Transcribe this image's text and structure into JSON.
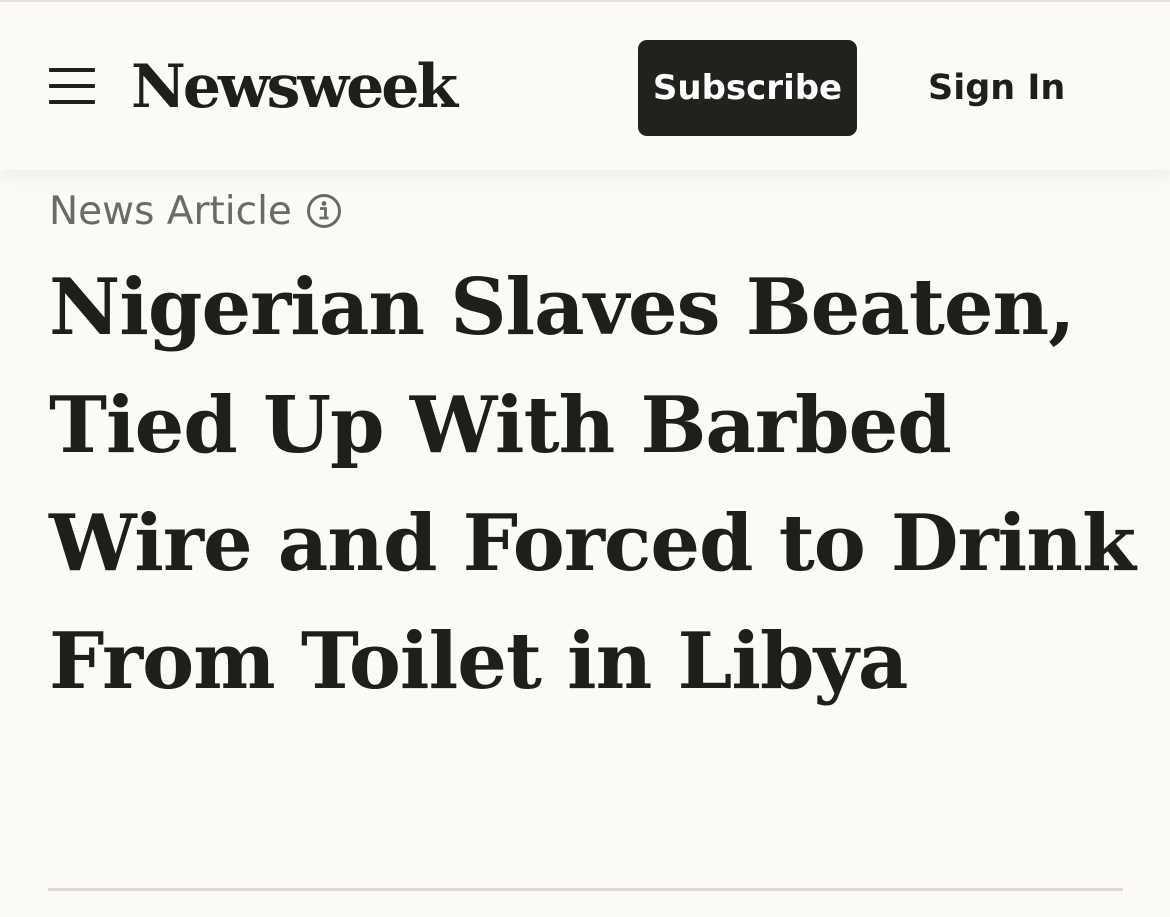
{
  "header": {
    "brand": "Newsweek",
    "subscribe_label": "Subscribe",
    "signin_label": "Sign In"
  },
  "article": {
    "kicker": "News Article",
    "headline": "Nigerian Slaves Beaten, Tied Up With Barbed Wire and Forced to Drink From Toilet in Libya"
  },
  "icons": {
    "menu": "hamburger-menu-icon",
    "info": "info-circle-icon"
  },
  "colors": {
    "background": "#fbfaf6",
    "text": "#1f1e1a",
    "button_bg": "#22211d",
    "button_text": "#ffffff",
    "kicker": "#6b6a64",
    "divider": "#dedbcc"
  }
}
